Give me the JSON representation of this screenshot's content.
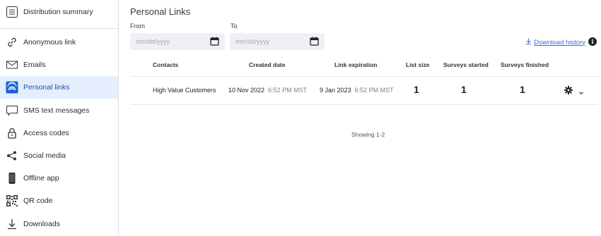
{
  "sidebar": {
    "items": [
      {
        "label": "Distribution summary",
        "icon": "list-icon"
      },
      {
        "label": "Anonymous link",
        "icon": "link-icon"
      },
      {
        "label": "Emails",
        "icon": "envelope-icon"
      },
      {
        "label": "Personal links",
        "icon": "fingerprint-icon",
        "active": true
      },
      {
        "label": "SMS text messages",
        "icon": "chat-bubble-icon"
      },
      {
        "label": "Access codes",
        "icon": "lock-icon"
      },
      {
        "label": "Social media",
        "icon": "share-icon"
      },
      {
        "label": "Offline app",
        "icon": "phone-icon"
      },
      {
        "label": "QR code",
        "icon": "qr-code-icon"
      },
      {
        "label": "Downloads",
        "icon": "download-icon"
      }
    ]
  },
  "main": {
    "title": "Personal Links",
    "from_label": "From",
    "to_label": "To",
    "from_placeholder": "mm/dd/yyyy",
    "to_placeholder": "mm/dd/yyyy",
    "download_history": "Download history",
    "table": {
      "headers": [
        "Contacts",
        "Created date",
        "Link expiration",
        "List size",
        "Surveys started",
        "Surveys finished"
      ],
      "rows": [
        {
          "contacts": "High Value Customers",
          "created_date": "10 Nov 2022",
          "created_time": "6:52 PM MST",
          "expiration_date": "9 Jan 2023",
          "expiration_time": "6:52 PM MST",
          "list_size": "1",
          "surveys_started": "1",
          "surveys_finished": "1"
        }
      ]
    },
    "showing": "Showing 1-2"
  },
  "colors": {
    "accent": "#3a6fd8",
    "active_bg": "#e4eefc",
    "active_icon": "#1a5fd0"
  }
}
